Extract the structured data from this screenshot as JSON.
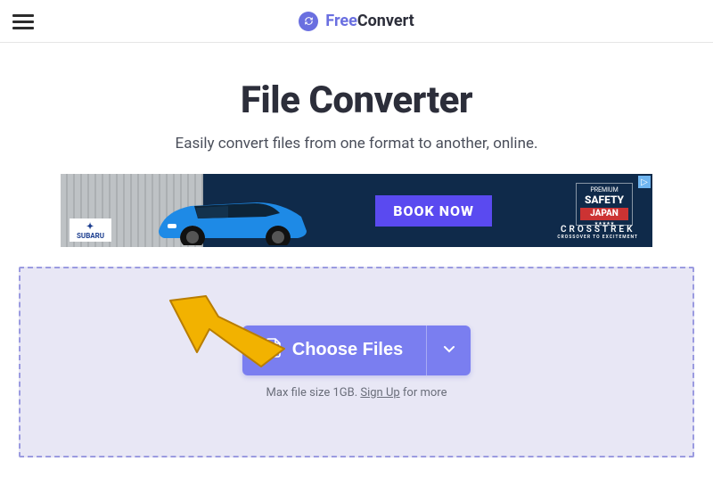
{
  "header": {
    "logo_free": "Free",
    "logo_convert": "Convert"
  },
  "main": {
    "title": "File Converter",
    "subtitle": "Easily convert files from one format to another, online."
  },
  "ad": {
    "brand": "SUBARU",
    "cta": "BOOK NOW",
    "badge_premium": "PREMIUM",
    "badge_safety": "SAFETY",
    "badge_japan": "JAPAN",
    "model": "CROSSTREK",
    "tagline": "CROSSOVER TO EXCITEMENT"
  },
  "dropzone": {
    "choose_label": "Choose Files",
    "hint_prefix": "Max file size 1GB. ",
    "hint_link": "Sign Up",
    "hint_suffix": " for more"
  }
}
